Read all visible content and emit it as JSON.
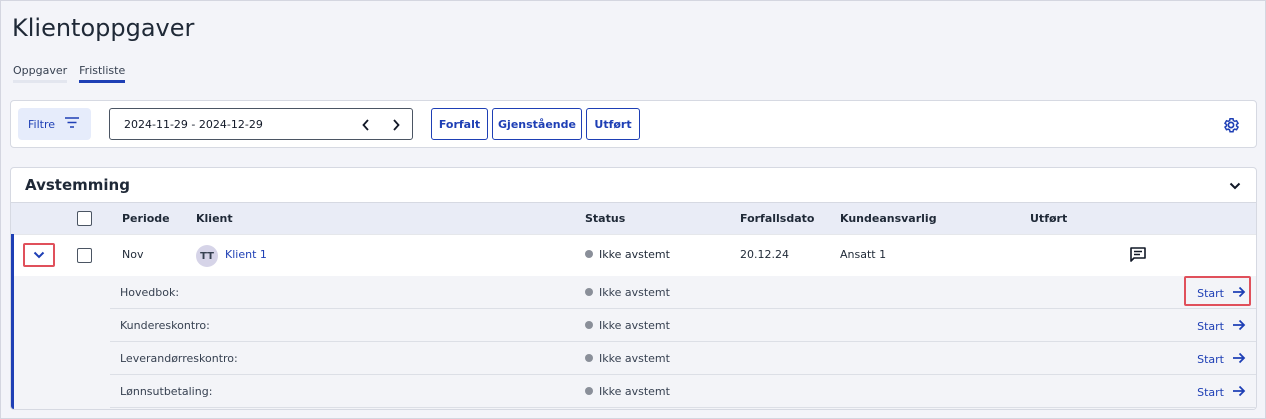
{
  "page": {
    "title": "Klientoppgaver"
  },
  "tabs": [
    {
      "label": "Oppgaver",
      "active": false
    },
    {
      "label": "Fristliste",
      "active": true
    }
  ],
  "toolbar": {
    "filter_label": "Filtre",
    "date_range": "2024-11-29 - 2024-12-29",
    "segments": {
      "forfalt": "Forfalt",
      "gjenstaende": "Gjenstående",
      "utfort": "Utført"
    },
    "icons": {
      "filter": "filter-icon",
      "prev": "chevron-left-icon",
      "next": "chevron-right-icon",
      "settings": "gear-icon"
    }
  },
  "panel": {
    "title": "Avstemming",
    "columns": {
      "periode": "Periode",
      "klient": "Klient",
      "status": "Status",
      "forfallsdato": "Forfallsdato",
      "kundeansvarlig": "Kundeansvarlig",
      "utfort": "Utført"
    },
    "row": {
      "periode": "Nov",
      "avatar_initials": "TT",
      "klient": "Klient 1",
      "status": "Ikke avstemt",
      "forfallsdato": "20.12.24",
      "kundeansvarlig": "Ansatt 1"
    },
    "subrows": [
      {
        "label": "Hovedbok:",
        "status": "Ikke avstemt",
        "action": "Start"
      },
      {
        "label": "Kundereskontro:",
        "status": "Ikke avstemt",
        "action": "Start"
      },
      {
        "label": "Leverandørreskontro:",
        "status": "Ikke avstemt",
        "action": "Start"
      },
      {
        "label": "Lønnsutbetaling:",
        "status": "Ikke avstemt",
        "action": "Start"
      }
    ]
  },
  "colors": {
    "accent": "#1e3fb5",
    "highlight": "#e0505b",
    "status_neutral": "#8a8f99"
  }
}
